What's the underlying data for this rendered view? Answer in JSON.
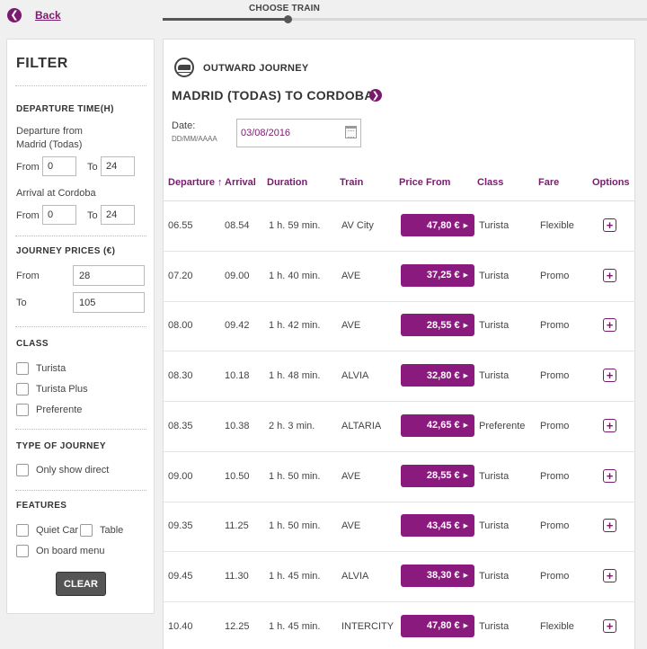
{
  "back": {
    "label": "Back"
  },
  "progress": {
    "label": "CHOOSE TRAIN",
    "fill": 0.26
  },
  "filter": {
    "title": "FILTER",
    "departure_time": {
      "heading": "DEPARTURE TIME(H)",
      "departure_label": "Departure from Madrid (Todas)",
      "arrival_label": "Arrival at Cordoba",
      "from_label": "From",
      "to_label": "To",
      "dep_from": "0",
      "dep_to": "24",
      "arr_from": "0",
      "arr_to": "24"
    },
    "prices": {
      "heading": "JOURNEY PRICES (€)",
      "from_label": "From",
      "to_label": "To",
      "from_value": "28",
      "to_value": "105"
    },
    "class": {
      "heading": "CLASS",
      "options": [
        "Turista",
        "Turista Plus",
        "Preferente"
      ]
    },
    "journey_type": {
      "heading": "TYPE OF JOURNEY",
      "option": "Only show direct"
    },
    "features": {
      "heading": "FEATURES",
      "options": [
        "Quiet Car",
        "Table",
        "On board menu"
      ]
    },
    "clear_label": "CLEAR"
  },
  "journey": {
    "label": "OUTWARD JOURNEY",
    "route": "MADRID (TODAS) TO CORDOBA",
    "date_label": "Date:",
    "date_hint": "DD/MM/AAAA",
    "date_value": "03/08/2016"
  },
  "table": {
    "headers": {
      "departure": "Departure",
      "sort_icon": "↑",
      "arrival": "Arrival",
      "duration": "Duration",
      "train": "Train",
      "price": "Price From",
      "class": "Class",
      "fare": "Fare",
      "options": "Options"
    },
    "rows": [
      {
        "departure": "06.55",
        "arrival": "08.54",
        "duration": "1 h. 59 min.",
        "train": "AV City",
        "price": "47,80 €",
        "class": "Turista",
        "fare": "Flexible"
      },
      {
        "departure": "07.20",
        "arrival": "09.00",
        "duration": "1 h. 40 min.",
        "train": "AVE",
        "price": "37,25 €",
        "class": "Turista",
        "fare": "Promo"
      },
      {
        "departure": "08.00",
        "arrival": "09.42",
        "duration": "1 h. 42 min.",
        "train": "AVE",
        "price": "28,55 €",
        "class": "Turista",
        "fare": "Promo"
      },
      {
        "departure": "08.30",
        "arrival": "10.18",
        "duration": "1 h. 48 min.",
        "train": "ALVIA",
        "price": "32,80 €",
        "class": "Turista",
        "fare": "Promo"
      },
      {
        "departure": "08.35",
        "arrival": "10.38",
        "duration": "2 h. 3 min.",
        "train": "ALTARIA",
        "price": "42,65 €",
        "class": "Preferente",
        "fare": "Promo"
      },
      {
        "departure": "09.00",
        "arrival": "10.50",
        "duration": "1 h. 50 min.",
        "train": "AVE",
        "price": "28,55 €",
        "class": "Turista",
        "fare": "Promo"
      },
      {
        "departure": "09.35",
        "arrival": "11.25",
        "duration": "1 h. 50 min.",
        "train": "AVE",
        "price": "43,45 €",
        "class": "Turista",
        "fare": "Promo"
      },
      {
        "departure": "09.45",
        "arrival": "11.30",
        "duration": "1 h. 45 min.",
        "train": "ALVIA",
        "price": "38,30 €",
        "class": "Turista",
        "fare": "Promo"
      },
      {
        "departure": "10.40",
        "arrival": "12.25",
        "duration": "1 h. 45 min.",
        "train": "INTERCITY",
        "price": "47,80 €",
        "class": "Turista",
        "fare": "Flexible"
      }
    ]
  },
  "colors": {
    "accent": "#7a1a6e",
    "price_button": "#8a1a7e",
    "clear_button": "#555555"
  }
}
